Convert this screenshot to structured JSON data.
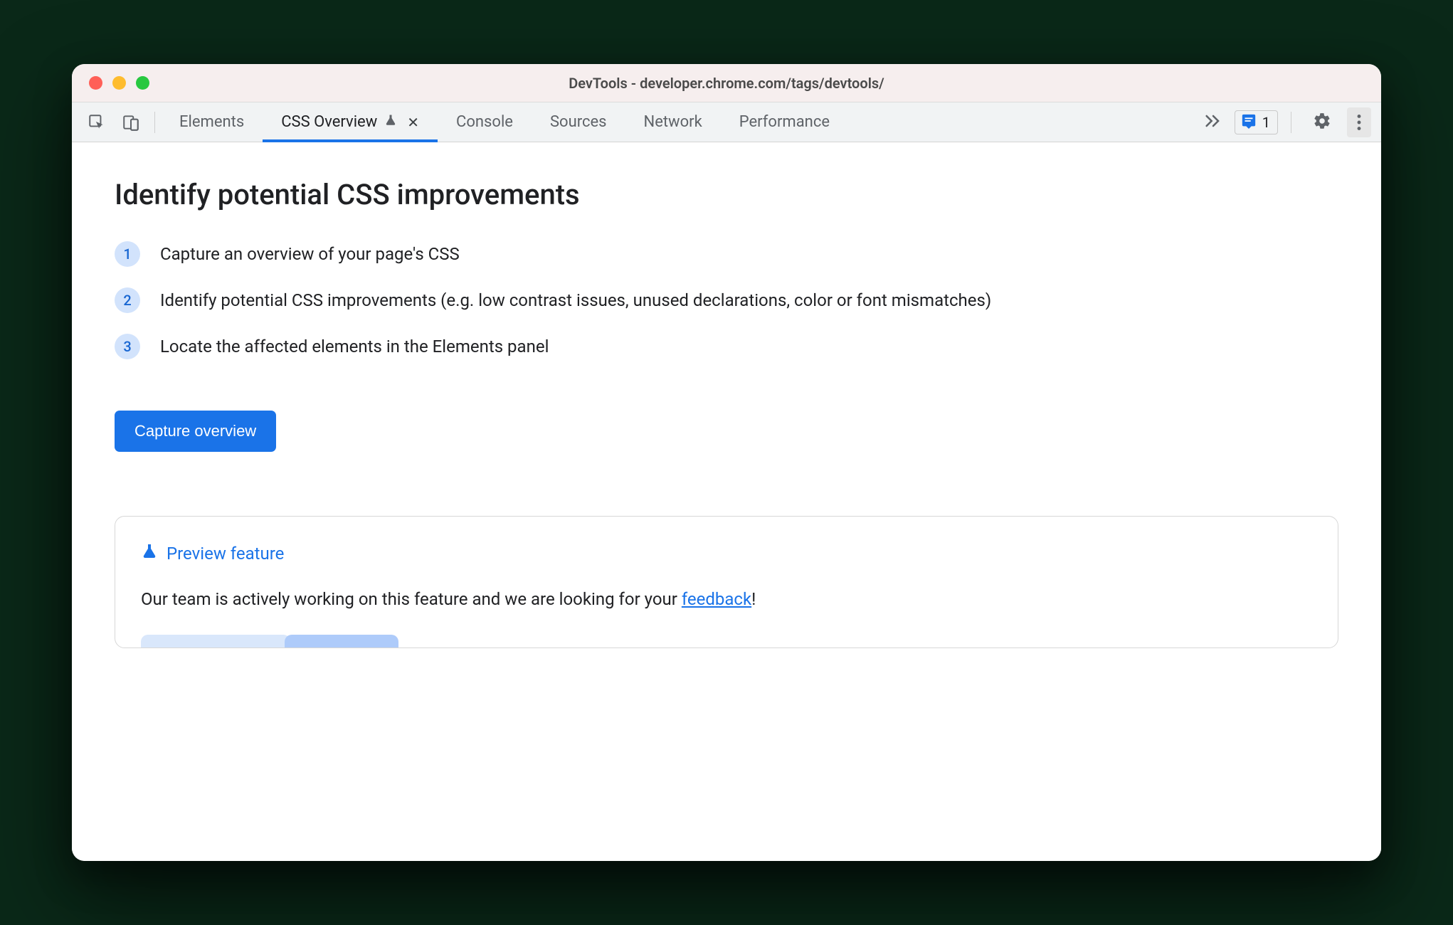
{
  "window": {
    "title": "DevTools - developer.chrome.com/tags/devtools/"
  },
  "tabs": {
    "items": [
      {
        "label": "Elements"
      },
      {
        "label": "CSS Overview"
      },
      {
        "label": "Console"
      },
      {
        "label": "Sources"
      },
      {
        "label": "Network"
      },
      {
        "label": "Performance"
      }
    ]
  },
  "issues": {
    "count": "1"
  },
  "main": {
    "heading": "Identify potential CSS improvements",
    "steps": [
      {
        "num": "1",
        "text": "Capture an overview of your page's CSS"
      },
      {
        "num": "2",
        "text": "Identify potential CSS improvements (e.g. low contrast issues, unused declarations, color or font mismatches)"
      },
      {
        "num": "3",
        "text": "Locate the affected elements in the Elements panel"
      }
    ],
    "capture_label": "Capture overview"
  },
  "preview": {
    "title": "Preview feature",
    "body_before": "Our team is actively working on this feature and we are looking for your ",
    "link_text": "feedback",
    "body_after": "!"
  }
}
